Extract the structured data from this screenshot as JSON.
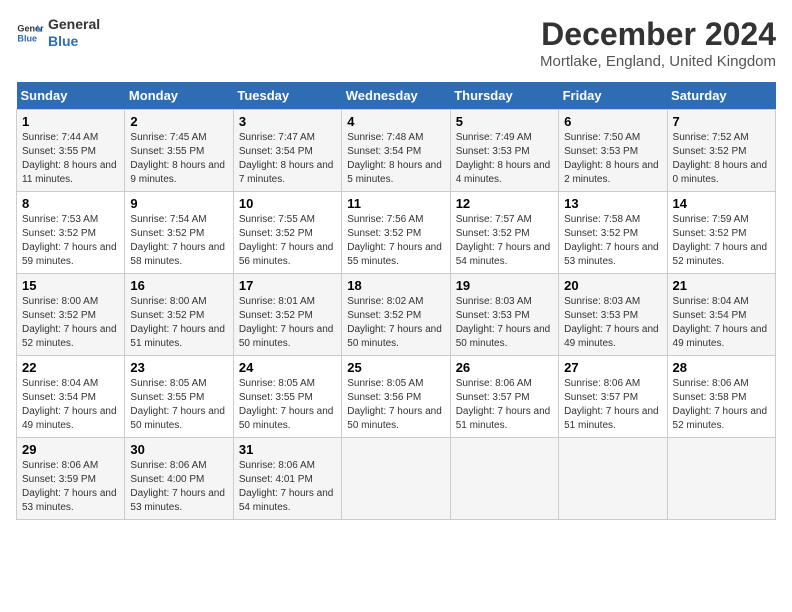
{
  "logo": {
    "line1": "General",
    "line2": "Blue"
  },
  "title": "December 2024",
  "subtitle": "Mortlake, England, United Kingdom",
  "days_header": [
    "Sunday",
    "Monday",
    "Tuesday",
    "Wednesday",
    "Thursday",
    "Friday",
    "Saturday"
  ],
  "weeks": [
    [
      {
        "day": "1",
        "sunrise": "Sunrise: 7:44 AM",
        "sunset": "Sunset: 3:55 PM",
        "daylight": "Daylight: 8 hours and 11 minutes."
      },
      {
        "day": "2",
        "sunrise": "Sunrise: 7:45 AM",
        "sunset": "Sunset: 3:55 PM",
        "daylight": "Daylight: 8 hours and 9 minutes."
      },
      {
        "day": "3",
        "sunrise": "Sunrise: 7:47 AM",
        "sunset": "Sunset: 3:54 PM",
        "daylight": "Daylight: 8 hours and 7 minutes."
      },
      {
        "day": "4",
        "sunrise": "Sunrise: 7:48 AM",
        "sunset": "Sunset: 3:54 PM",
        "daylight": "Daylight: 8 hours and 5 minutes."
      },
      {
        "day": "5",
        "sunrise": "Sunrise: 7:49 AM",
        "sunset": "Sunset: 3:53 PM",
        "daylight": "Daylight: 8 hours and 4 minutes."
      },
      {
        "day": "6",
        "sunrise": "Sunrise: 7:50 AM",
        "sunset": "Sunset: 3:53 PM",
        "daylight": "Daylight: 8 hours and 2 minutes."
      },
      {
        "day": "7",
        "sunrise": "Sunrise: 7:52 AM",
        "sunset": "Sunset: 3:52 PM",
        "daylight": "Daylight: 8 hours and 0 minutes."
      }
    ],
    [
      {
        "day": "8",
        "sunrise": "Sunrise: 7:53 AM",
        "sunset": "Sunset: 3:52 PM",
        "daylight": "Daylight: 7 hours and 59 minutes."
      },
      {
        "day": "9",
        "sunrise": "Sunrise: 7:54 AM",
        "sunset": "Sunset: 3:52 PM",
        "daylight": "Daylight: 7 hours and 58 minutes."
      },
      {
        "day": "10",
        "sunrise": "Sunrise: 7:55 AM",
        "sunset": "Sunset: 3:52 PM",
        "daylight": "Daylight: 7 hours and 56 minutes."
      },
      {
        "day": "11",
        "sunrise": "Sunrise: 7:56 AM",
        "sunset": "Sunset: 3:52 PM",
        "daylight": "Daylight: 7 hours and 55 minutes."
      },
      {
        "day": "12",
        "sunrise": "Sunrise: 7:57 AM",
        "sunset": "Sunset: 3:52 PM",
        "daylight": "Daylight: 7 hours and 54 minutes."
      },
      {
        "day": "13",
        "sunrise": "Sunrise: 7:58 AM",
        "sunset": "Sunset: 3:52 PM",
        "daylight": "Daylight: 7 hours and 53 minutes."
      },
      {
        "day": "14",
        "sunrise": "Sunrise: 7:59 AM",
        "sunset": "Sunset: 3:52 PM",
        "daylight": "Daylight: 7 hours and 52 minutes."
      }
    ],
    [
      {
        "day": "15",
        "sunrise": "Sunrise: 8:00 AM",
        "sunset": "Sunset: 3:52 PM",
        "daylight": "Daylight: 7 hours and 52 minutes."
      },
      {
        "day": "16",
        "sunrise": "Sunrise: 8:00 AM",
        "sunset": "Sunset: 3:52 PM",
        "daylight": "Daylight: 7 hours and 51 minutes."
      },
      {
        "day": "17",
        "sunrise": "Sunrise: 8:01 AM",
        "sunset": "Sunset: 3:52 PM",
        "daylight": "Daylight: 7 hours and 50 minutes."
      },
      {
        "day": "18",
        "sunrise": "Sunrise: 8:02 AM",
        "sunset": "Sunset: 3:52 PM",
        "daylight": "Daylight: 7 hours and 50 minutes."
      },
      {
        "day": "19",
        "sunrise": "Sunrise: 8:03 AM",
        "sunset": "Sunset: 3:53 PM",
        "daylight": "Daylight: 7 hours and 50 minutes."
      },
      {
        "day": "20",
        "sunrise": "Sunrise: 8:03 AM",
        "sunset": "Sunset: 3:53 PM",
        "daylight": "Daylight: 7 hours and 49 minutes."
      },
      {
        "day": "21",
        "sunrise": "Sunrise: 8:04 AM",
        "sunset": "Sunset: 3:54 PM",
        "daylight": "Daylight: 7 hours and 49 minutes."
      }
    ],
    [
      {
        "day": "22",
        "sunrise": "Sunrise: 8:04 AM",
        "sunset": "Sunset: 3:54 PM",
        "daylight": "Daylight: 7 hours and 49 minutes."
      },
      {
        "day": "23",
        "sunrise": "Sunrise: 8:05 AM",
        "sunset": "Sunset: 3:55 PM",
        "daylight": "Daylight: 7 hours and 50 minutes."
      },
      {
        "day": "24",
        "sunrise": "Sunrise: 8:05 AM",
        "sunset": "Sunset: 3:55 PM",
        "daylight": "Daylight: 7 hours and 50 minutes."
      },
      {
        "day": "25",
        "sunrise": "Sunrise: 8:05 AM",
        "sunset": "Sunset: 3:56 PM",
        "daylight": "Daylight: 7 hours and 50 minutes."
      },
      {
        "day": "26",
        "sunrise": "Sunrise: 8:06 AM",
        "sunset": "Sunset: 3:57 PM",
        "daylight": "Daylight: 7 hours and 51 minutes."
      },
      {
        "day": "27",
        "sunrise": "Sunrise: 8:06 AM",
        "sunset": "Sunset: 3:57 PM",
        "daylight": "Daylight: 7 hours and 51 minutes."
      },
      {
        "day": "28",
        "sunrise": "Sunrise: 8:06 AM",
        "sunset": "Sunset: 3:58 PM",
        "daylight": "Daylight: 7 hours and 52 minutes."
      }
    ],
    [
      {
        "day": "29",
        "sunrise": "Sunrise: 8:06 AM",
        "sunset": "Sunset: 3:59 PM",
        "daylight": "Daylight: 7 hours and 53 minutes."
      },
      {
        "day": "30",
        "sunrise": "Sunrise: 8:06 AM",
        "sunset": "Sunset: 4:00 PM",
        "daylight": "Daylight: 7 hours and 53 minutes."
      },
      {
        "day": "31",
        "sunrise": "Sunrise: 8:06 AM",
        "sunset": "Sunset: 4:01 PM",
        "daylight": "Daylight: 7 hours and 54 minutes."
      },
      null,
      null,
      null,
      null
    ]
  ]
}
